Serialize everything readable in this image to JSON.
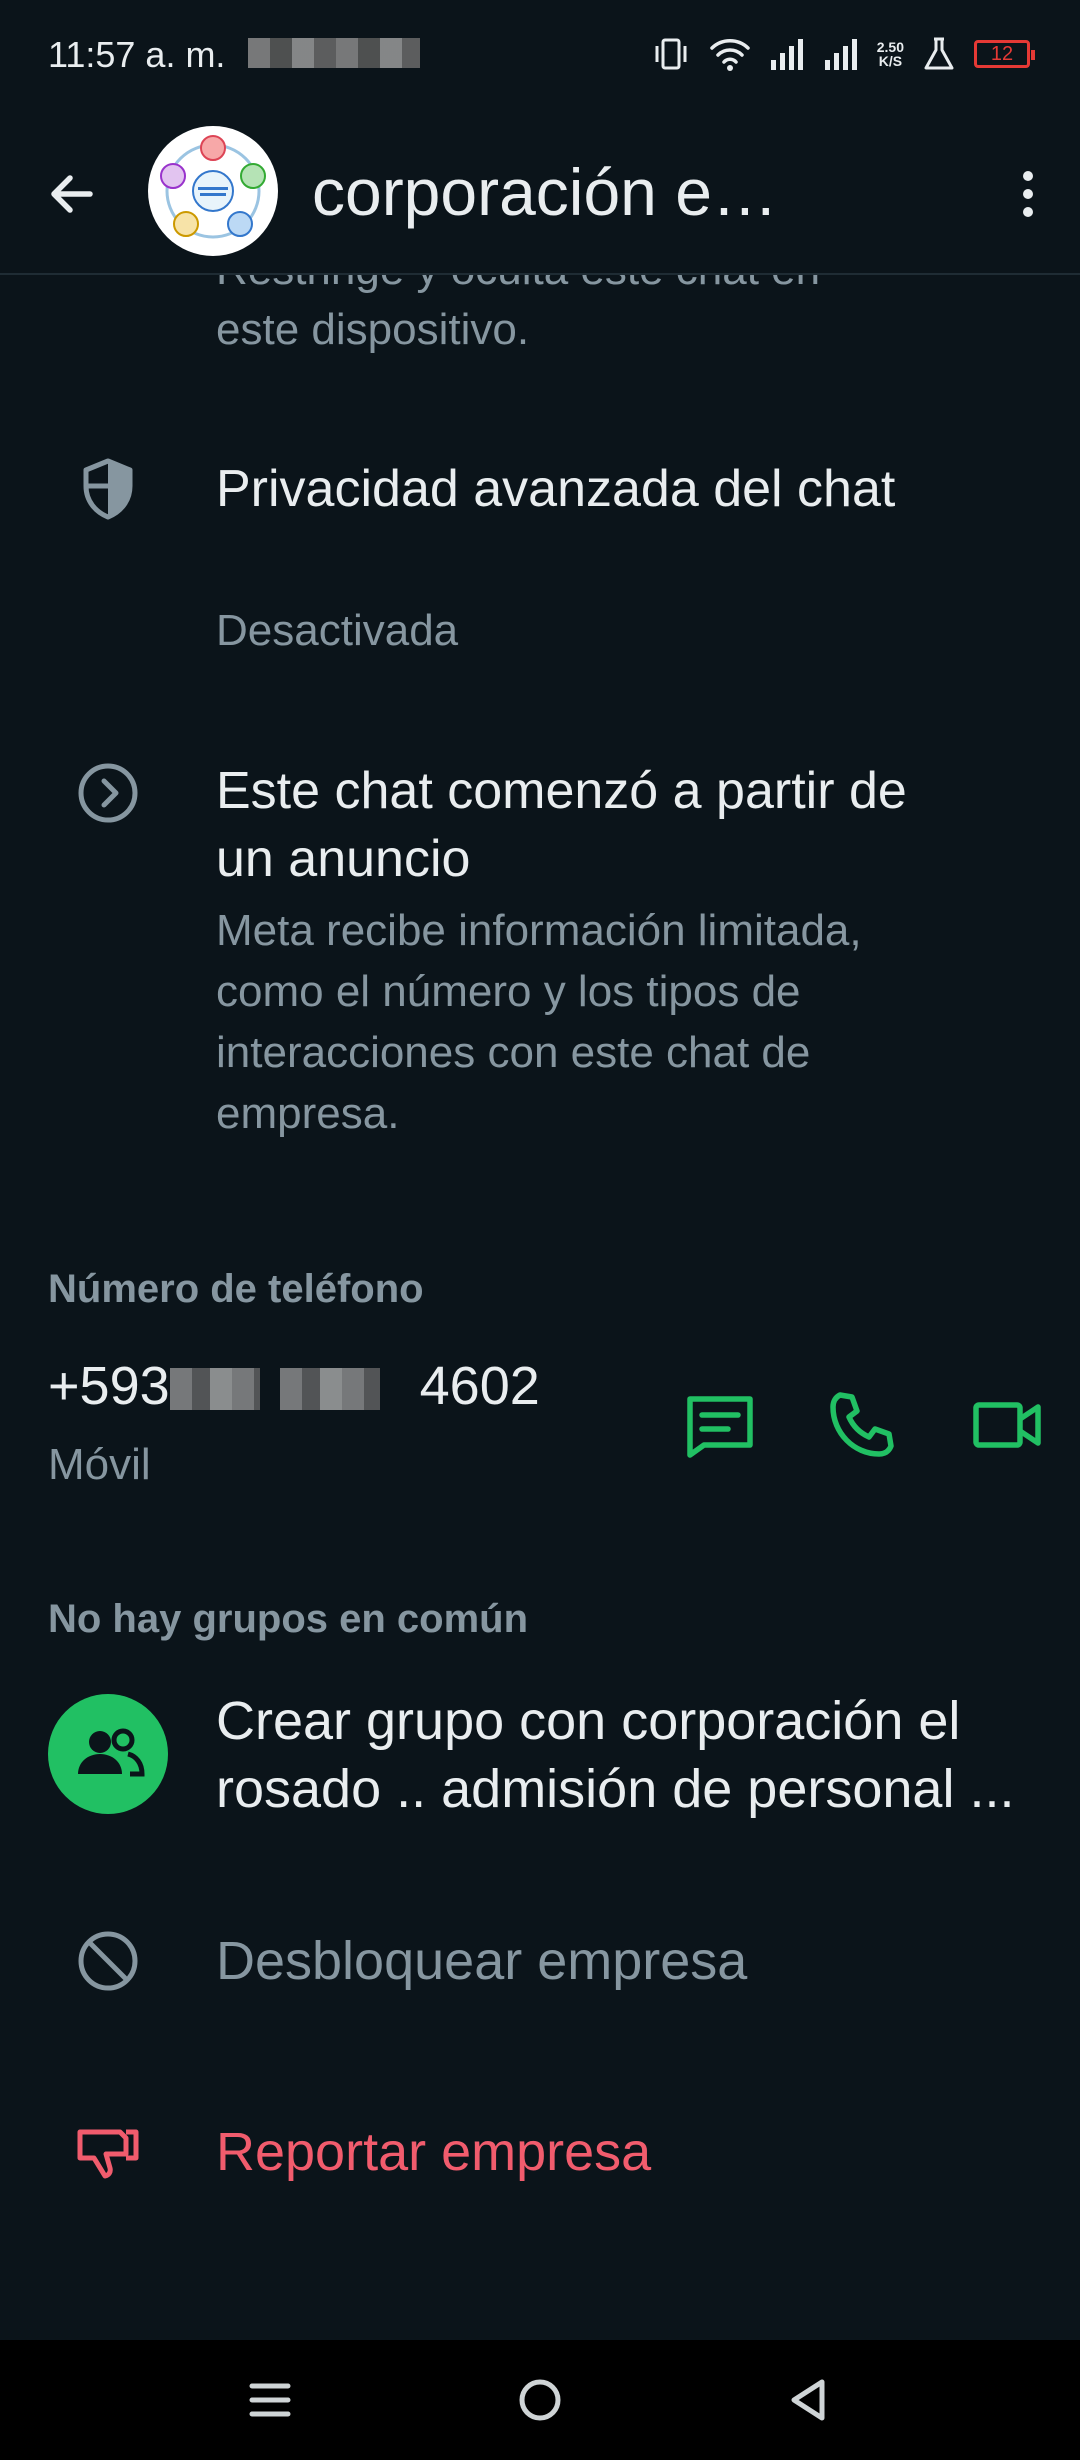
{
  "status_bar": {
    "time": "11:57 a. m.",
    "speed_value": "2.50",
    "speed_unit": "K/S",
    "battery": "12"
  },
  "header": {
    "title": "corporación el rosado .. admisión de personal ..."
  },
  "content": {
    "partial_text": "Restringe y oculta este chat en este dispositivo.",
    "privacy": {
      "title": "Privacidad avanzada del chat",
      "status": "Desactivada"
    },
    "ad": {
      "title": "Este chat comenzó a partir de un anuncio",
      "description": "Meta recibe información limitada, como el número y los tipos de interacciones con este chat de empresa."
    },
    "phone_section": {
      "heading": "Número de teléfono",
      "prefix": "+593",
      "suffix": "4602",
      "label": "Móvil"
    },
    "groups": {
      "heading": "No hay grupos en común",
      "create_label": "Crear grupo con corporación el rosado .. admisión de personal ..."
    },
    "unblock_label": "Desbloquear empresa",
    "report_label": "Reportar empresa"
  },
  "colors": {
    "background": "#0b141a",
    "accent_green": "#21c063",
    "danger_red": "#f15c6d",
    "muted_text": "#8696a0"
  },
  "icons": [
    "back-arrow-icon",
    "more-options-icon",
    "shield-icon",
    "chevron-circle-icon",
    "message-icon",
    "phone-icon",
    "video-icon",
    "group-icon",
    "block-icon",
    "thumbs-down-icon"
  ]
}
